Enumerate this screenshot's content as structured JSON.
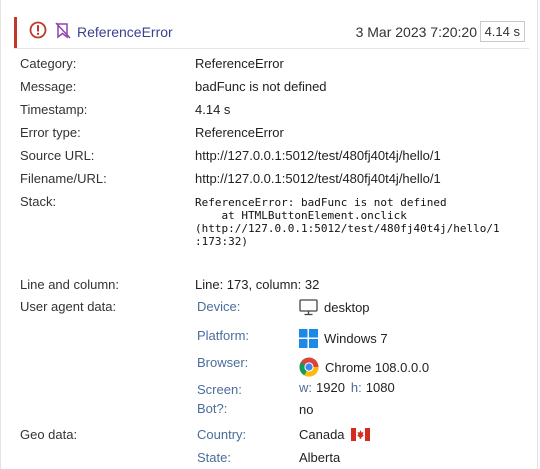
{
  "header": {
    "title": "ReferenceError",
    "date": "3 Mar 2023 7:20:20",
    "duration": "4.14 s"
  },
  "fields": {
    "category": {
      "label": "Category:",
      "value": "ReferenceError"
    },
    "message": {
      "label": "Message:",
      "value": "badFunc is not defined"
    },
    "timestamp": {
      "label": "Timestamp:",
      "value": "4.14 s"
    },
    "error_type": {
      "label": "Error type:",
      "value": "ReferenceError"
    },
    "source_url": {
      "label": "Source URL:",
      "value": "http://127.0.0.1:5012/test/480fj40t4j/hello/1"
    },
    "filename_url": {
      "label": "Filename/URL:",
      "value": "http://127.0.0.1:5012/test/480fj40t4j/hello/1"
    },
    "stack": {
      "label": "Stack:",
      "value": "ReferenceError: badFunc is not defined\n    at HTMLButtonElement.onclick\n(http://127.0.0.1:5012/test/480fj40t4j/hello/1\n:173:32)"
    },
    "line_column": {
      "label": "Line and column:",
      "value": "Line: 173, column: 32"
    },
    "user_agent": {
      "label": "User agent data:"
    },
    "geo": {
      "label": "Geo data:"
    }
  },
  "user_agent": {
    "device": {
      "label": "Device:",
      "value": "desktop",
      "icon": "monitor-icon"
    },
    "platform": {
      "label": "Platform:",
      "value": "Windows 7",
      "icon": "windows-icon"
    },
    "browser": {
      "label": "Browser:",
      "value": "Chrome 108.0.0.0",
      "icon": "chrome-icon"
    },
    "screen": {
      "label": "Screen:",
      "w_label": "w:",
      "w_value": "1920",
      "h_label": "h:",
      "h_value": "1080"
    },
    "bot": {
      "label": "Bot?:",
      "value": "no"
    }
  },
  "geo": {
    "country": {
      "label": "Country:",
      "value": "Canada",
      "icon": "canada-flag-icon"
    },
    "state": {
      "label": "State:",
      "value": "Alberta"
    }
  },
  "colors": {
    "accent_red": "#c0392b",
    "link_blue": "#4a6d9c",
    "title_blue": "#3b3f8f"
  }
}
